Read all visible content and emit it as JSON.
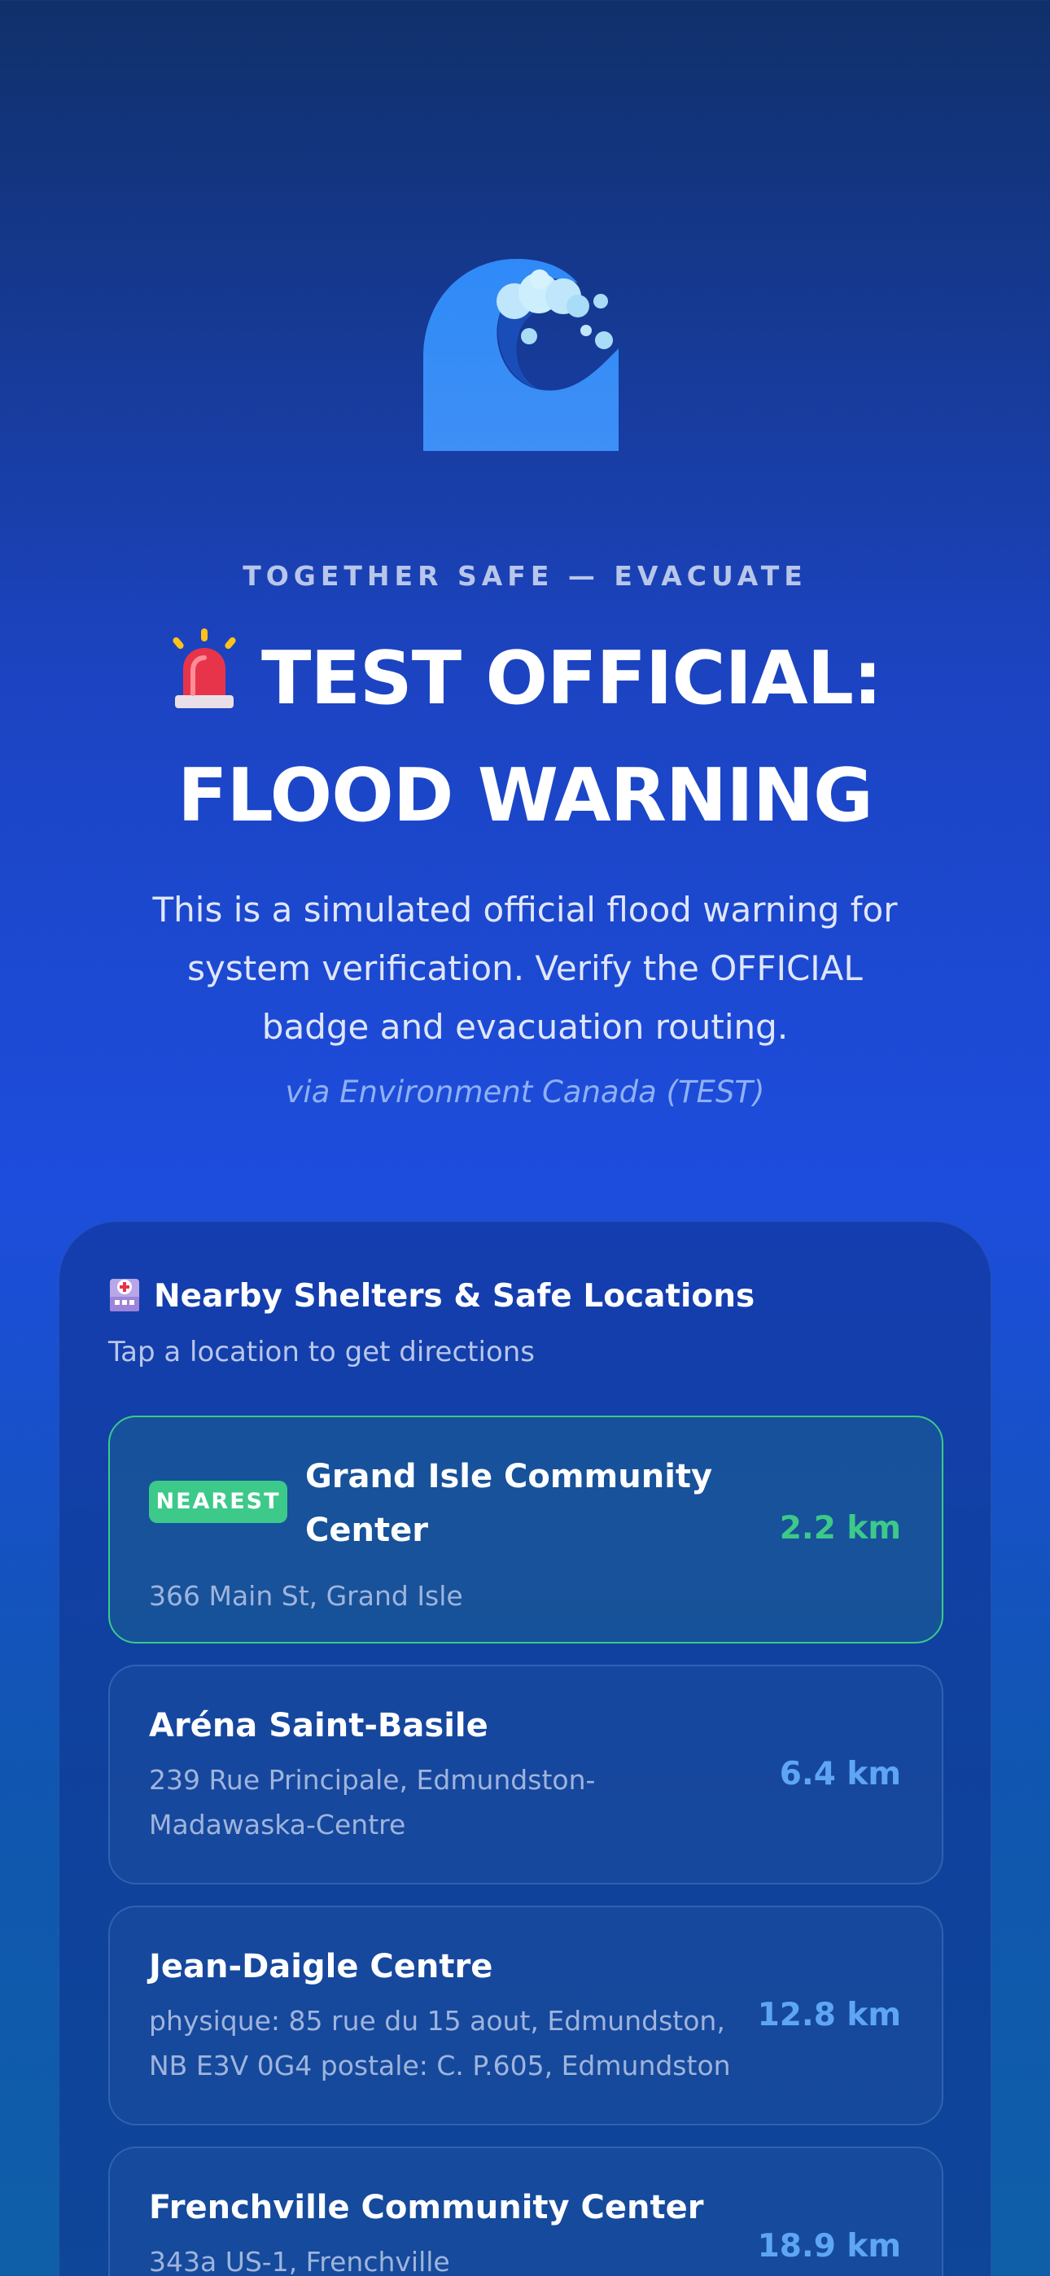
{
  "hero": {
    "icon": "water-wave-icon",
    "kicker": "TOGETHER SAFE — EVACUATE",
    "alert_icon": "siren-icon",
    "title": "TEST OFFICIAL: FLOOD WARNING",
    "description": "This is a simulated official flood warning for system verification. Verify the OFFICIAL badge and evacuation routing.",
    "source": "via Environment Canada (TEST)"
  },
  "shelters": {
    "icon": "hospital-icon",
    "title": "Nearby Shelters & Safe Locations",
    "subtitle": "Tap a location to get directions",
    "items": [
      {
        "badge": "NEAREST",
        "name": "Grand Isle Community Center",
        "address": "366 Main St, Grand Isle",
        "distance": "2.2 km"
      },
      {
        "name": "Aréna Saint-Basile",
        "address": "239 Rue Principale, Edmundston-Madawaska-Centre",
        "distance": "6.4 km"
      },
      {
        "name": "Jean-Daigle Centre",
        "address": "physique: 85 rue du 15 aout, Edmundston, NB E3V 0G4 postale: C. P.605, Edmundston",
        "distance": "12.8 km"
      },
      {
        "name": "Frenchville Community Center",
        "address": "343a US-1, Frenchville",
        "distance": "18.9 km"
      }
    ]
  },
  "colors": {
    "background_top": "#10306a",
    "background_mid": "#1d4ddd",
    "accent_green": "#3cc98a",
    "accent_blue": "#5ea6f5"
  }
}
